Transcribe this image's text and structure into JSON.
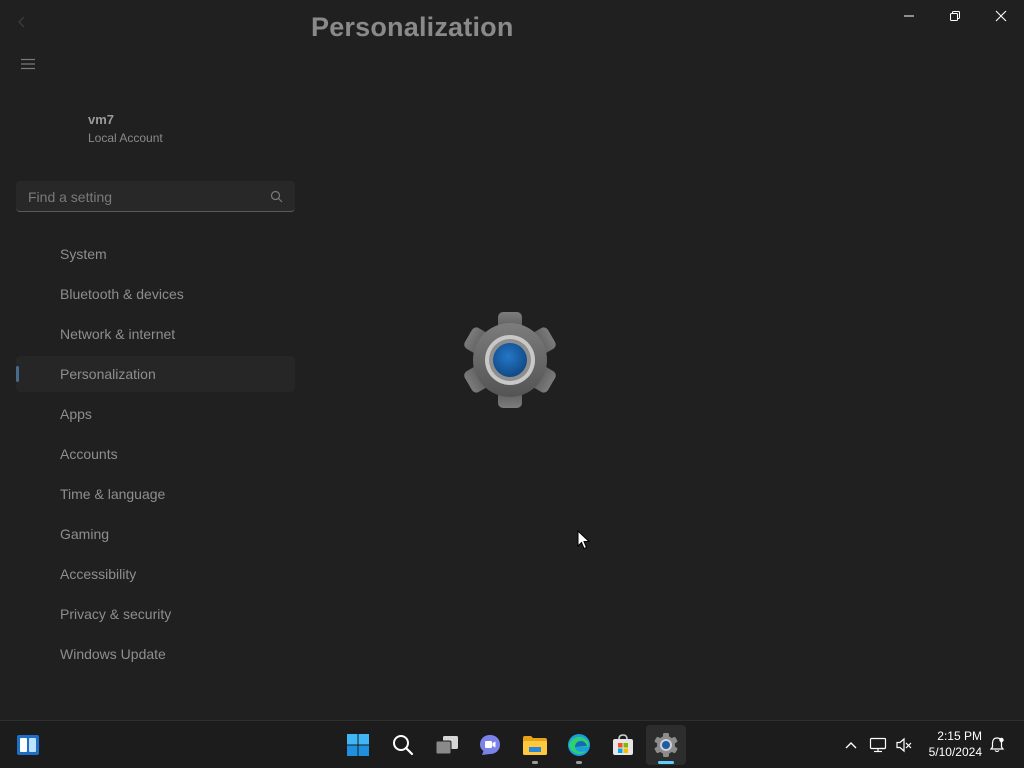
{
  "window": {
    "title": "Personalization",
    "controls": {
      "minimize": "minimize",
      "restore": "restore",
      "close": "close"
    }
  },
  "user": {
    "name": "vm7",
    "account_type": "Local Account"
  },
  "search": {
    "placeholder": "Find a setting",
    "value": ""
  },
  "nav": {
    "items": [
      {
        "label": "System"
      },
      {
        "label": "Bluetooth & devices"
      },
      {
        "label": "Network & internet"
      },
      {
        "label": "Personalization",
        "selected": true
      },
      {
        "label": "Apps"
      },
      {
        "label": "Accounts"
      },
      {
        "label": "Time & language"
      },
      {
        "label": "Gaming"
      },
      {
        "label": "Accessibility"
      },
      {
        "label": "Privacy & security"
      },
      {
        "label": "Windows Update"
      }
    ]
  },
  "splash": {
    "icon": "settings-gear-icon"
  },
  "taskbar": {
    "pinned": [
      {
        "name": "start-icon"
      },
      {
        "name": "search-icon"
      },
      {
        "name": "task-view-icon"
      },
      {
        "name": "teams-chat-icon"
      },
      {
        "name": "file-explorer-icon"
      },
      {
        "name": "edge-icon"
      },
      {
        "name": "store-icon"
      },
      {
        "name": "settings-icon",
        "active": true
      }
    ],
    "tray": [
      "chevron-up-icon",
      "network-icon",
      "volume-muted-icon",
      "notifications-icon"
    ],
    "clock": {
      "time": "2:15 PM",
      "date": "5/10/2024"
    }
  },
  "colors": {
    "background": "#202020",
    "taskbar": "#1c1c1c",
    "accent": "#60cdff",
    "gear_center": "#1a5ea8"
  }
}
